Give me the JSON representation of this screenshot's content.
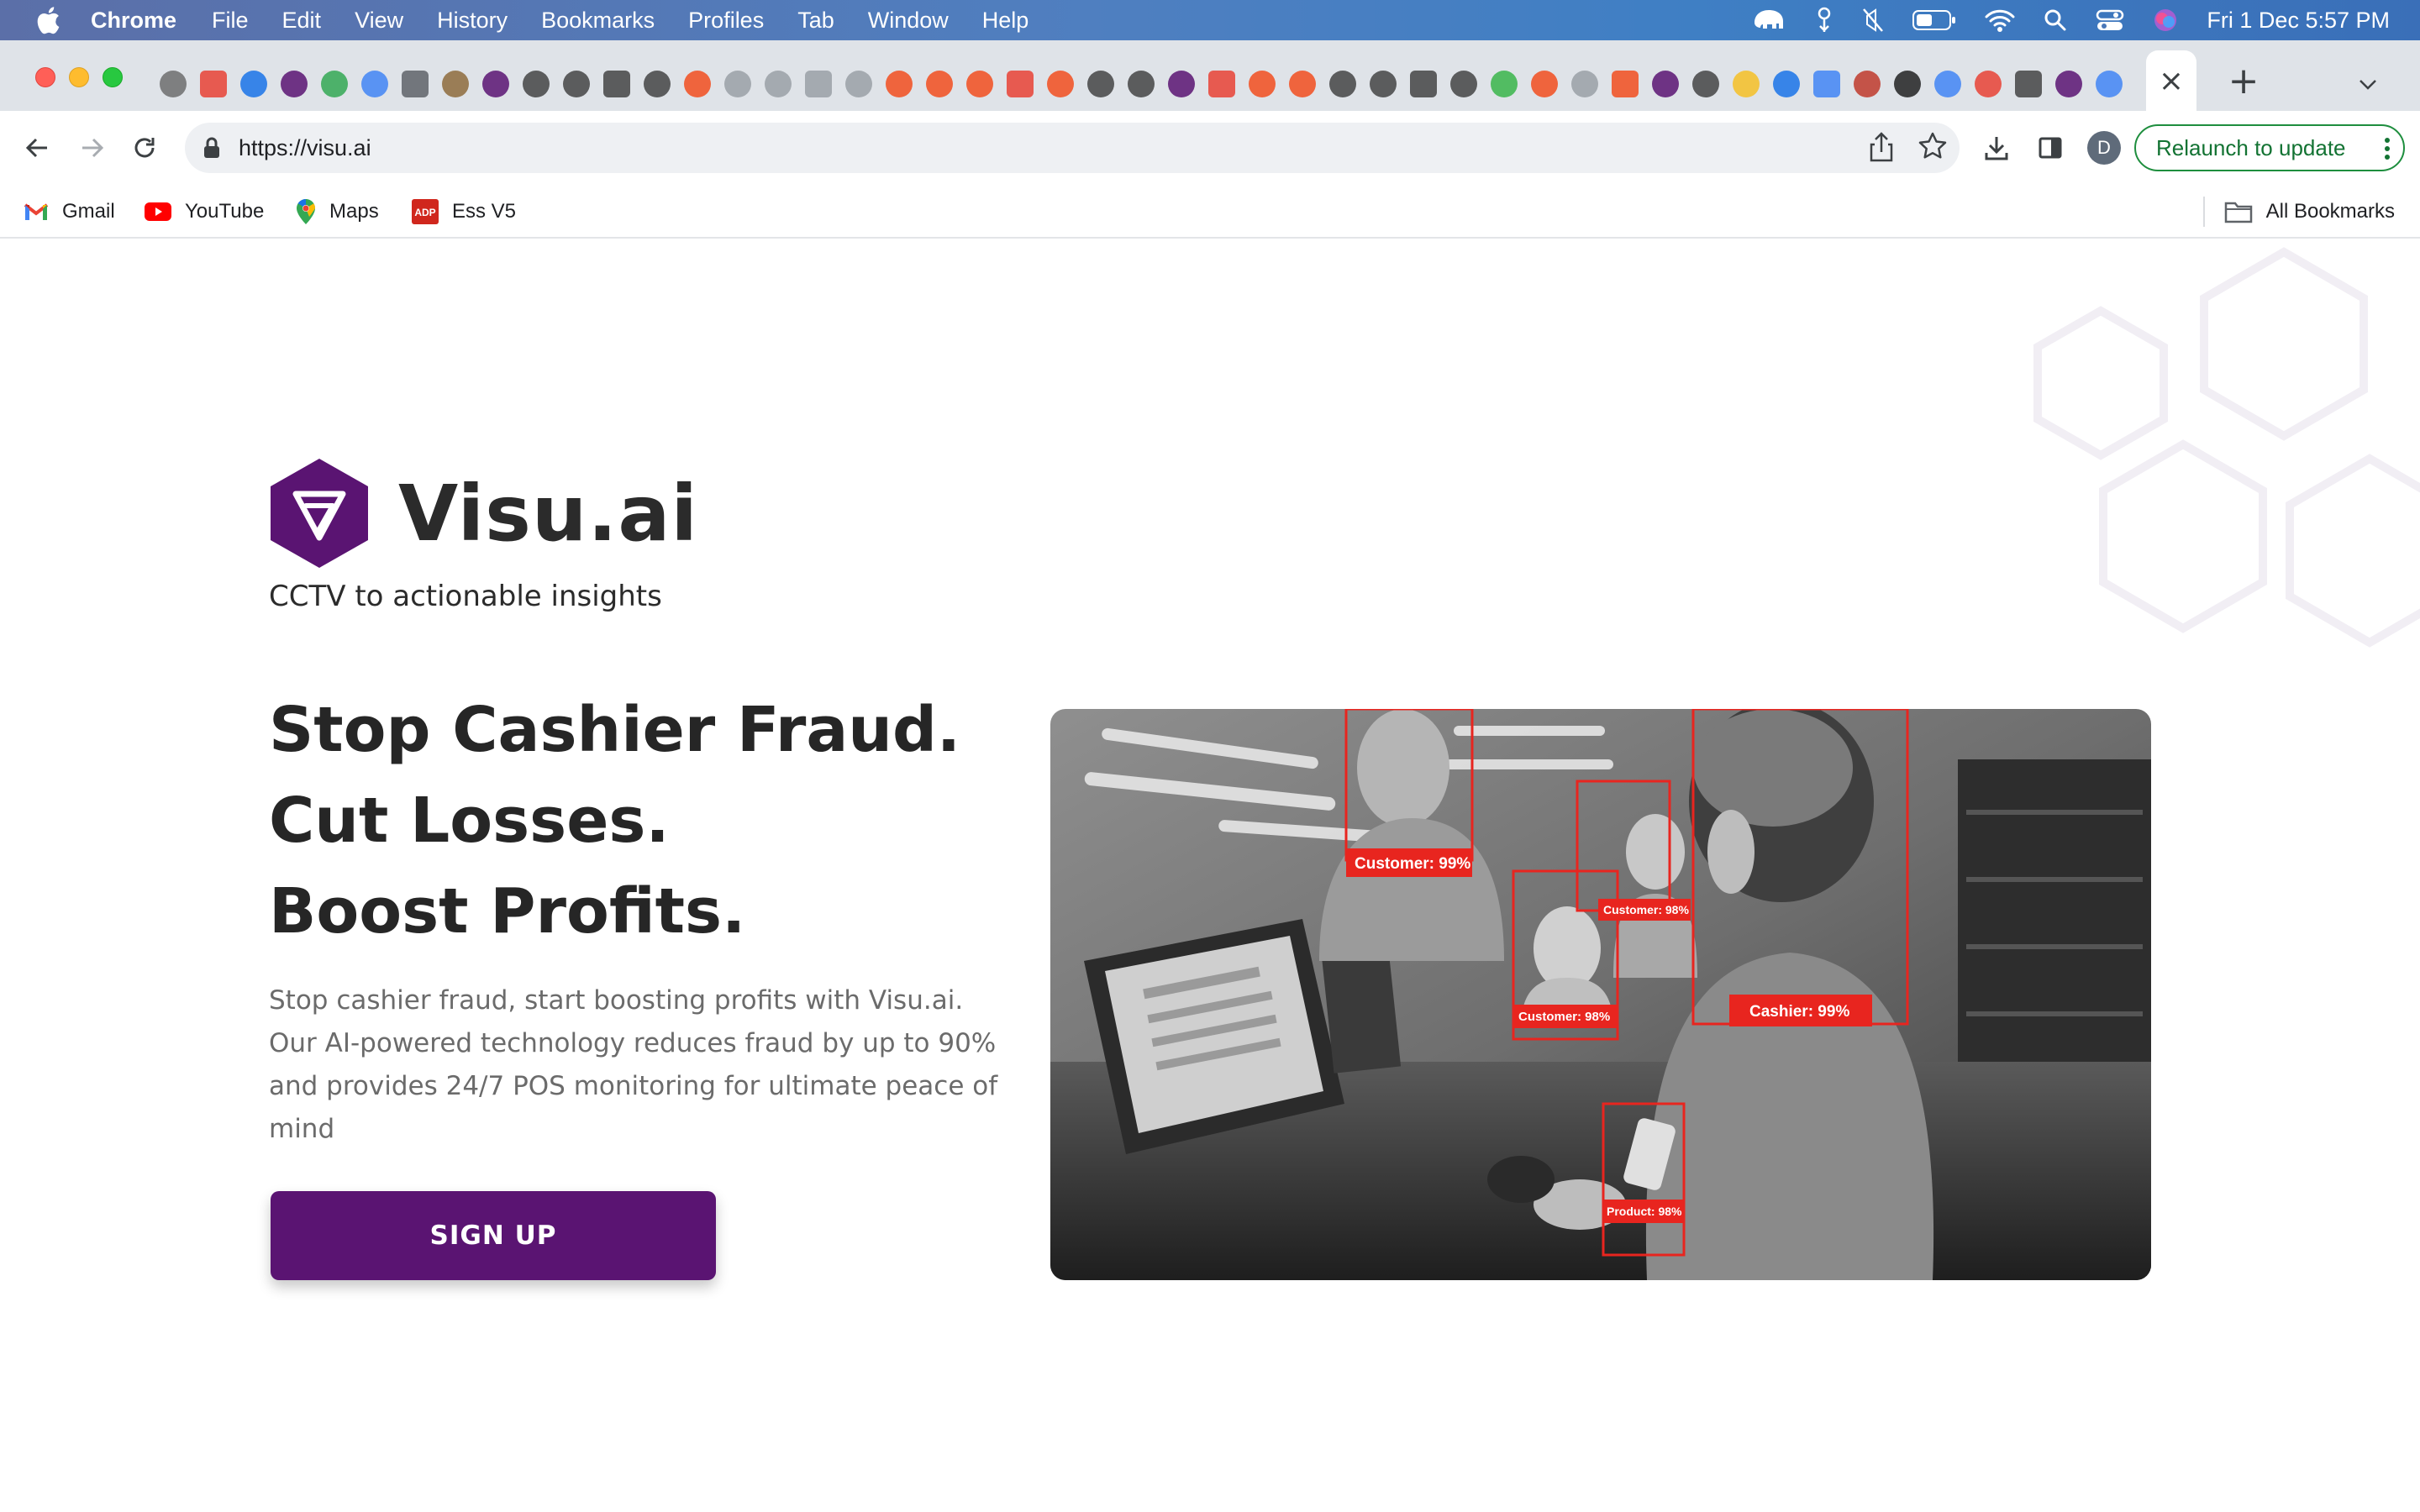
{
  "menubar": {
    "app_name": "Chrome",
    "items": [
      "File",
      "Edit",
      "View",
      "History",
      "Bookmarks",
      "Profiles",
      "Tab",
      "Window",
      "Help"
    ],
    "clock": "Fri 1 Dec  5:57 PM",
    "status_icons": [
      "elephant-icon",
      "bluetooth-like-icon",
      "mute-icon",
      "battery-icon",
      "wifi-icon",
      "spotlight-search-icon",
      "control-center-icon",
      "siri-icon"
    ]
  },
  "tabs": {
    "active_tab_close": "×",
    "new_tab": "+"
  },
  "toolbar": {
    "url": "https://visu.ai",
    "profile_initial": "D",
    "relaunch_label": "Relaunch to update"
  },
  "bookmarks": {
    "items": [
      {
        "label": "Gmail",
        "icon": "gmail-icon"
      },
      {
        "label": "YouTube",
        "icon": "youtube-icon"
      },
      {
        "label": "Maps",
        "icon": "maps-icon"
      },
      {
        "label": "Ess V5",
        "icon": "adp-icon"
      }
    ],
    "all_label": "All Bookmarks"
  },
  "page": {
    "brand": "Visu.ai",
    "tagline": "CCTV to actionable insights",
    "headline": [
      "Stop Cashier Fraud.",
      "Cut Losses.",
      "Boost Profits."
    ],
    "description": "Stop cashier fraud, start boosting profits with Visu.ai. Our AI-powered technology reduces fraud by up to 90% and provides 24/7 POS monitoring for ultimate peace of mind",
    "cta": "SIGN UP",
    "detections": [
      "Customer: 99%",
      "Customer: 98%",
      "Customer: 98%",
      "Cashier: 99%",
      "Product: 98%"
    ]
  },
  "colors": {
    "brand_purple": "#5a1472",
    "detection_red": "#e8251f",
    "relaunch_green": "#1e8e3e"
  }
}
